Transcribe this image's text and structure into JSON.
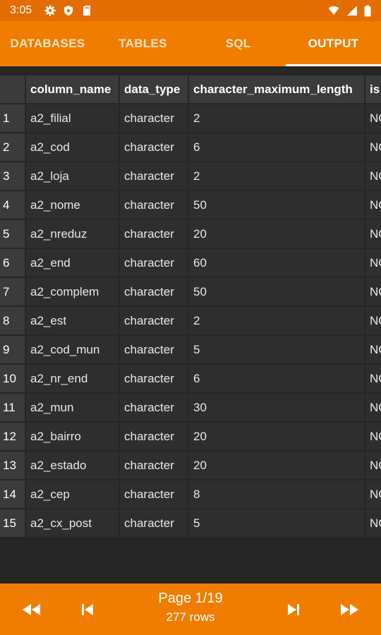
{
  "status_bar": {
    "time": "3:05",
    "left_icons": [
      "gear-icon",
      "shield-icon",
      "sd-card-icon"
    ],
    "right_icons": [
      "wifi-icon",
      "signal-icon",
      "battery-icon"
    ]
  },
  "tabs": [
    {
      "label": "DATABASES",
      "active": false
    },
    {
      "label": "TABLES",
      "active": false
    },
    {
      "label": "SQL",
      "active": false
    },
    {
      "label": "OUTPUT",
      "active": true
    }
  ],
  "table": {
    "columns": [
      "column_name",
      "data_type",
      "character_maximum_length",
      "is"
    ],
    "rows": [
      {
        "num": "1",
        "column_name": "a2_filial",
        "data_type": "character",
        "length": "2",
        "is": "NO"
      },
      {
        "num": "2",
        "column_name": "a2_cod",
        "data_type": "character",
        "length": "6",
        "is": "NO"
      },
      {
        "num": "3",
        "column_name": "a2_loja",
        "data_type": "character",
        "length": "2",
        "is": "NO"
      },
      {
        "num": "4",
        "column_name": "a2_nome",
        "data_type": "character",
        "length": "50",
        "is": "NO"
      },
      {
        "num": "5",
        "column_name": "a2_nreduz",
        "data_type": "character",
        "length": "20",
        "is": "NO"
      },
      {
        "num": "6",
        "column_name": "a2_end",
        "data_type": "character",
        "length": "60",
        "is": "NO"
      },
      {
        "num": "7",
        "column_name": "a2_complem",
        "data_type": "character",
        "length": "50",
        "is": "NO"
      },
      {
        "num": "8",
        "column_name": "a2_est",
        "data_type": "character",
        "length": "2",
        "is": "NO"
      },
      {
        "num": "9",
        "column_name": "a2_cod_mun",
        "data_type": "character",
        "length": "5",
        "is": "NO"
      },
      {
        "num": "10",
        "column_name": "a2_nr_end",
        "data_type": "character",
        "length": "6",
        "is": "NO"
      },
      {
        "num": "11",
        "column_name": "a2_mun",
        "data_type": "character",
        "length": "30",
        "is": "NO"
      },
      {
        "num": "12",
        "column_name": "a2_bairro",
        "data_type": "character",
        "length": "20",
        "is": "NO"
      },
      {
        "num": "13",
        "column_name": "a2_estado",
        "data_type": "character",
        "length": "20",
        "is": "NO"
      },
      {
        "num": "14",
        "column_name": "a2_cep",
        "data_type": "character",
        "length": "8",
        "is": "NO"
      },
      {
        "num": "15",
        "column_name": "a2_cx_post",
        "data_type": "character",
        "length": "5",
        "is": "NO"
      }
    ]
  },
  "footer": {
    "page_label": "Page 1/19",
    "rows_label": "277 rows",
    "buttons": [
      "first-page-icon",
      "previous-page-icon",
      "next-page-icon",
      "last-page-icon"
    ]
  },
  "colors": {
    "accent": "#f07d00",
    "status_bar": "#e36d02",
    "background": "#262626",
    "cell": "#2e2e2e",
    "header_cell": "#3b3b3b"
  }
}
